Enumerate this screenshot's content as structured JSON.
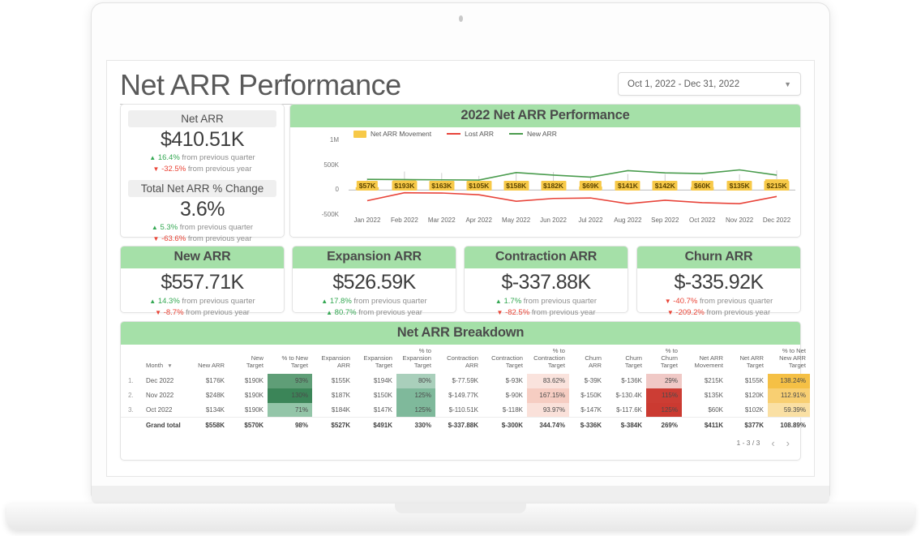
{
  "header": {
    "title": "Net ARR Performance",
    "date_range": "Oct 1, 2022 - Dec 31, 2022",
    "caret_icon": "chevron-down-icon"
  },
  "left_kpis": [
    {
      "label": "Net ARR",
      "value": "$410.51K",
      "delta_q": "16.4%",
      "delta_q_dir": "up",
      "delta_q_text": "from previous quarter",
      "delta_y": "-32.5%",
      "delta_y_dir": "down",
      "delta_y_text": "from previous year"
    },
    {
      "label": "Total Net ARR % Change",
      "value": "3.6%",
      "delta_q": "5.3%",
      "delta_q_dir": "up",
      "delta_q_text": "from previous quarter",
      "delta_y": "-63.6%",
      "delta_y_dir": "down",
      "delta_y_text": "from previous year"
    }
  ],
  "kpi_cards": [
    {
      "label": "New ARR",
      "value": "$557.71K",
      "delta_q": "14.3%",
      "delta_q_dir": "up",
      "delta_q_text": "from previous quarter",
      "delta_y": "-8.7%",
      "delta_y_dir": "down",
      "delta_y_text": "from previous year"
    },
    {
      "label": "Expansion ARR",
      "value": "$526.59K",
      "delta_q": "17.8%",
      "delta_q_dir": "up",
      "delta_q_text": "from previous quarter",
      "delta_y": "80.7%",
      "delta_y_dir": "up",
      "delta_y_text": "from previous year"
    },
    {
      "label": "Contraction ARR",
      "value": "$-337.88K",
      "delta_q": "1.7%",
      "delta_q_dir": "up",
      "delta_q_text": "from previous quarter",
      "delta_y": "-82.5%",
      "delta_y_dir": "down",
      "delta_y_text": "from previous year"
    },
    {
      "label": "Churn ARR",
      "value": "$-335.92K",
      "delta_q": "-40.7%",
      "delta_q_dir": "down",
      "delta_q_text": "from previous quarter",
      "delta_y": "-209.2%",
      "delta_y_dir": "down",
      "delta_y_text": "from previous year"
    }
  ],
  "chart_data": {
    "type": "bar",
    "title": "2022 Net ARR Performance",
    "xlabel": "",
    "ylabel": "",
    "ylim": [
      -500000,
      1000000
    ],
    "ytick_labels": [
      "1M",
      "500K",
      "0",
      "-500K"
    ],
    "ytick_values": [
      1000000,
      500000,
      0,
      -500000
    ],
    "grid": false,
    "legend_position": "top-left",
    "categories": [
      "Jan 2022",
      "Feb 2022",
      "Mar 2022",
      "Apr 2022",
      "May 2022",
      "Jun 2022",
      "Jul 2022",
      "Aug 2022",
      "Sep 2022",
      "Oct 2022",
      "Nov 2022",
      "Dec 2022"
    ],
    "series": [
      {
        "name": "Net ARR Movement",
        "type": "bar",
        "color": "#f7c948",
        "values": [
          57000,
          193000,
          163000,
          105000,
          158000,
          182000,
          69000,
          141000,
          142000,
          60000,
          135000,
          215000
        ],
        "data_labels": [
          "$57K",
          "$193K",
          "$163K",
          "$105K",
          "$158K",
          "$182K",
          "$69K",
          "$141K",
          "$142K",
          "$60K",
          "$135K",
          "$215K"
        ]
      },
      {
        "name": "Lost ARR",
        "type": "line",
        "color": "#e8443a",
        "values": [
          -215000,
          -55000,
          -60000,
          -95000,
          -225000,
          -170000,
          -160000,
          -275000,
          -205000,
          -255000,
          -275000,
          -130000
        ]
      },
      {
        "name": "New ARR",
        "type": "line",
        "color": "#4a9c4e",
        "values": [
          215000,
          210000,
          205000,
          200000,
          350000,
          300000,
          260000,
          390000,
          345000,
          330000,
          405000,
          300000
        ]
      }
    ]
  },
  "table": {
    "title": "Net ARR Breakdown",
    "sort_icon": "sort-descending-icon",
    "columns": [
      "Month",
      "New ARR",
      "New Target",
      "% to New Target",
      "Expansion ARR",
      "Expansion Target",
      "% to Expansion Target",
      "Contraction ARR",
      "Contraction Target",
      "% to Contraction Target",
      "Churn ARR",
      "Churn Target",
      "% to Churn Target",
      "Net ARR Movement",
      "Net ARR Target",
      "% to Net New ARR Target"
    ],
    "rows": [
      {
        "idx": "1.",
        "month": "Dec 2022",
        "cells": [
          "$176K",
          "$190K",
          "93%",
          "$155K",
          "$194K",
          "80%",
          "$-77.59K",
          "$-93K",
          "83.62%",
          "$-39K",
          "$-136K",
          "29%",
          "$215K",
          "$155K",
          "138.24%"
        ],
        "fills": [
          null,
          null,
          "#5f9e77",
          null,
          null,
          "#a9cfbb",
          null,
          null,
          "#fae3dd",
          null,
          null,
          "#f0c9c6",
          null,
          null,
          "#f5c045"
        ]
      },
      {
        "idx": "2.",
        "month": "Nov 2022",
        "cells": [
          "$248K",
          "$190K",
          "130%",
          "$187K",
          "$150K",
          "125%",
          "$-149.77K",
          "$-90K",
          "167.15%",
          "$-150K",
          "$-130.4K",
          "115%",
          "$135K",
          "$120K",
          "112.91%"
        ],
        "fills": [
          null,
          null,
          "#3b8558",
          null,
          null,
          "#7fb99b",
          null,
          null,
          "#f6cdc2",
          null,
          null,
          "#cc3d34",
          null,
          null,
          "#f8cf72"
        ]
      },
      {
        "idx": "3.",
        "month": "Oct 2022",
        "cells": [
          "$134K",
          "$190K",
          "71%",
          "$184K",
          "$147K",
          "125%",
          "$-110.51K",
          "$-118K",
          "93.97%",
          "$-147K",
          "$-117.6K",
          "125%",
          "$60K",
          "$102K",
          "59.39%"
        ],
        "fills": [
          null,
          null,
          "#93c5a8",
          null,
          null,
          "#7fb99b",
          null,
          null,
          "#fae1da",
          null,
          null,
          "#cb3a31",
          null,
          null,
          "#fae0a4"
        ]
      }
    ],
    "total_row": {
      "label": "Grand total",
      "cells": [
        "$558K",
        "$570K",
        "98%",
        "$527K",
        "$491K",
        "330%",
        "$-337.88K",
        "$-300K",
        "344.74%",
        "$-336K",
        "$-384K",
        "269%",
        "$411K",
        "$377K",
        "108.89%"
      ]
    },
    "pagination": {
      "range": "1 - 3 / 3",
      "prev_icon": "chevron-left-icon",
      "next_icon": "chevron-right-icon"
    }
  },
  "colors": {
    "accent_green": "#a5e0a8",
    "bar_yellow": "#f7c948",
    "line_red": "#e8443a",
    "line_green": "#4a9c4e",
    "positive": "#34a853",
    "negative": "#ea4335"
  }
}
